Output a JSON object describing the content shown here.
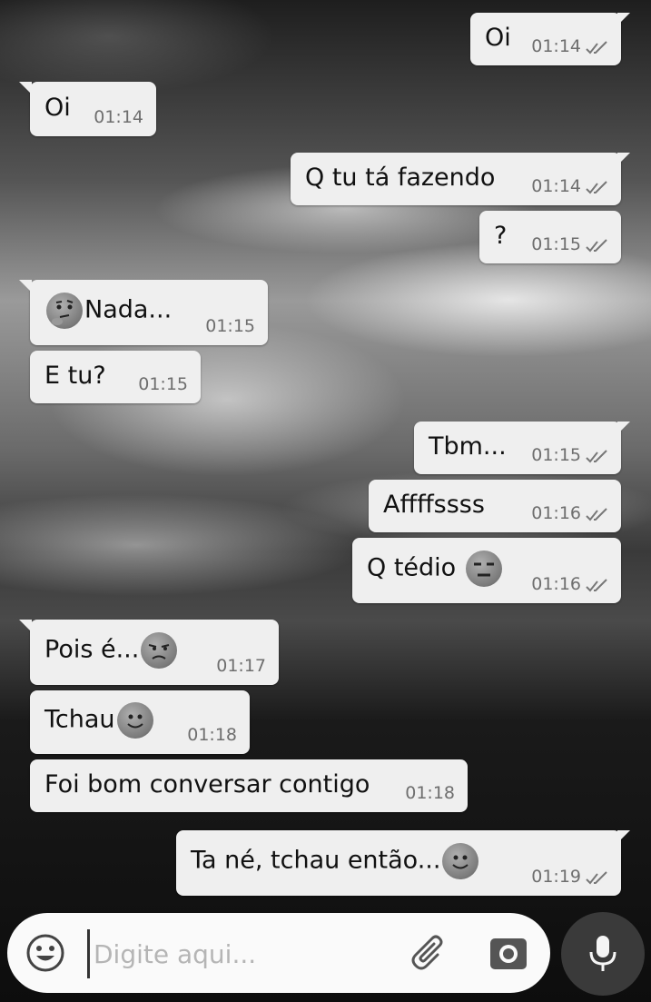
{
  "messages": [
    {
      "dir": "out",
      "text": "Oi",
      "time": "01:14"
    },
    {
      "dir": "in",
      "text": "Oi",
      "time": "01:14"
    },
    {
      "dir": "out",
      "text": "Q tu tá fazendo",
      "time": "01:14"
    },
    {
      "dir": "out",
      "text": "?",
      "time": "01:15"
    },
    {
      "dir": "in",
      "text": "Nada...",
      "time": "01:15",
      "emoji_before": "thinking-face-emoji"
    },
    {
      "dir": "in",
      "text": "E tu?",
      "time": "01:15"
    },
    {
      "dir": "out",
      "text": "Tbm...",
      "time": "01:15"
    },
    {
      "dir": "out",
      "text": "Affffssss",
      "time": "01:16"
    },
    {
      "dir": "out",
      "text": "Q tédio ",
      "time": "01:16",
      "emoji_after": "expressionless-face-emoji"
    },
    {
      "dir": "in",
      "text": "Pois é...",
      "time": "01:17",
      "emoji_after": "unamused-face-emoji"
    },
    {
      "dir": "in",
      "text": "Tchau",
      "time": "01:18",
      "emoji_after": "smiling-face-emoji"
    },
    {
      "dir": "in",
      "text": "Foi bom conversar contigo",
      "time": "01:18"
    },
    {
      "dir": "out",
      "text": "Ta né, tchau então...",
      "time": "01:19",
      "emoji_after": "smiling-face-emoji"
    }
  ],
  "composer": {
    "placeholder": "Digite aqui...",
    "emoji_icon": "emoji-icon",
    "attach_icon": "paperclip-icon",
    "camera_icon": "camera-icon",
    "mic_icon": "microphone-icon"
  },
  "colors": {
    "bubble": "#efefef",
    "time": "#6e6e6e",
    "mic_button": "#3a3a3a"
  }
}
